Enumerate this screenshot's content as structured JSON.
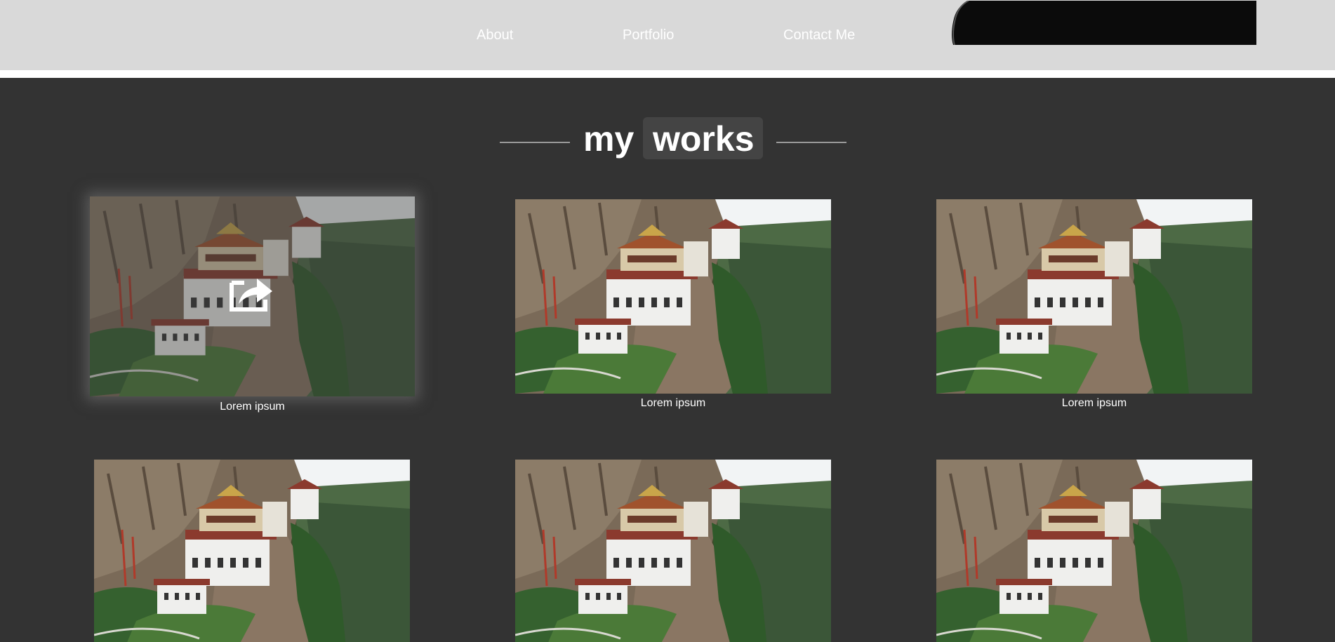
{
  "nav": {
    "about": "About",
    "portfolio": "Portfolio",
    "contact": "Contact Me"
  },
  "section": {
    "title_part1": "my",
    "title_part2": "works"
  },
  "works": [
    {
      "caption": "Lorem ipsum",
      "state": "hover"
    },
    {
      "caption": "Lorem ipsum",
      "state": "normal"
    },
    {
      "caption": "Lorem ipsum",
      "state": "normal"
    },
    {
      "caption": "",
      "state": "normal"
    },
    {
      "caption": "",
      "state": "normal"
    },
    {
      "caption": "",
      "state": "normal"
    }
  ],
  "icons": {
    "overlay_icon": "share-icon"
  },
  "colors": {
    "header_bg": "#d9d9d9",
    "page_bg": "#333333",
    "title_box": "#444444",
    "text": "#ffffff"
  }
}
